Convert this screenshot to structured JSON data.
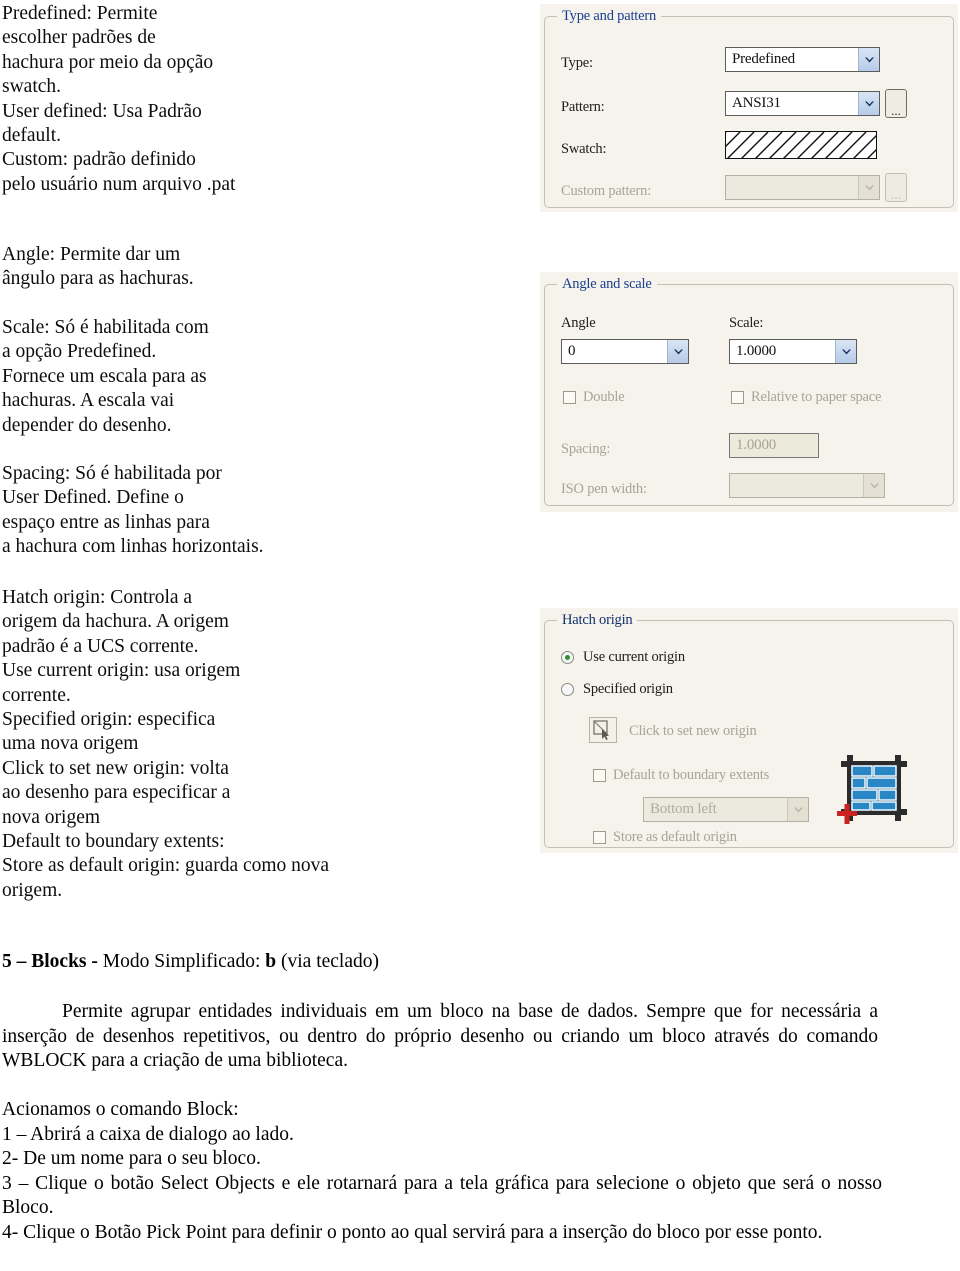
{
  "document": {
    "left_column": {
      "predefined_block": "Predefined: Permite\nescolher padrões de\nhachura por meio da opção\nswatch.\nUser defined: Usa Padrão\ndefault.\nCustom: padrão definido\npelo usuário num arquivo .pat",
      "angle_block": "Angle: Permite dar um\nângulo para as hachuras.",
      "scale_block": "Scale: Só é habilitada com\na opção Predefined.\nFornece um escala para as\nhachuras. A escala vai\ndepender do desenho.",
      "spacing_block": "Spacing: Só é habilitada por\nUser Defined. Define o\nespaço entre as linhas para\na hachura com linhas horizontais.",
      "hatch_origin_block": "Hatch origin: Controla a\norigem da hachura. A origem\npadrão é a UCS corrente.\nUse current origin: usa origem\ncorrente.\nSpecified origin: especifica\numa nova origem\nClick to set new origin: volta\nao desenho para especificar a\nnova origem\nDefault to boundary extents:\nStore as default origin: guarda como nova\norigem."
    },
    "blocks_section": {
      "heading_number": "5 – Blocks",
      "heading_sep": " - ",
      "heading_mode": "Modo Simplificado: ",
      "heading_key": "b",
      "heading_tail": " (via teclado)",
      "paragraph": "Permite agrupar entidades individuais em um bloco na base de dados. Sempre que for necessária a inserção de desenhos repetitivos, ou dentro do próprio desenho ou criando um bloco através do comando WBLOCK para a criação de uma biblioteca.",
      "steps_intro": "Acionamos o comando Block:",
      "steps": [
        "1 – Abrirá a caixa de dialogo ao lado.",
        "2- De um nome para o seu bloco.",
        "3 – Clique o botão Select Objects e ele rotarnará para a tela gráfica para selecione o objeto que será o nosso Bloco.",
        "4- Clique o Botão Pick Point para definir o ponto ao qual servirá para a inserção do bloco por esse ponto."
      ]
    }
  },
  "dialogs": {
    "type_and_pattern": {
      "group_title": "Type and pattern",
      "type_label": "Type:",
      "type_value": "Predefined",
      "pattern_label": "Pattern:",
      "pattern_value": "ANSI31",
      "pattern_browse": "...",
      "swatch_label": "Swatch:",
      "custom_pattern_label": "Custom pattern:",
      "custom_pattern_value": "",
      "custom_browse": "..."
    },
    "angle_and_scale": {
      "group_title": "Angle and scale",
      "angle_label": "Angle",
      "angle_value": "0",
      "scale_label": "Scale:",
      "scale_value": "1.0000",
      "double_label": "Double",
      "relative_label": "Relative to paper space",
      "spacing_label": "Spacing:",
      "spacing_value": "1.0000",
      "iso_pen_label": "ISO pen width:",
      "iso_pen_value": ""
    },
    "hatch_origin": {
      "group_title": "Hatch origin",
      "use_current_label": "Use current origin",
      "specified_label": "Specified origin",
      "click_set_label": "Click to set new origin",
      "default_extents_label": "Default to boundary extents",
      "extents_value": "Bottom left",
      "store_default_label": "Store as default origin"
    }
  },
  "colors": {
    "group_title_blue": "#1b3f8f",
    "panel_background": "#f5f3ec",
    "combo_arrow_blue": "#b6cbe8",
    "radio_dot_green": "#2f8f2f",
    "brick_blue": "#1f6ea8",
    "crosshair_red": "#cc2222"
  }
}
